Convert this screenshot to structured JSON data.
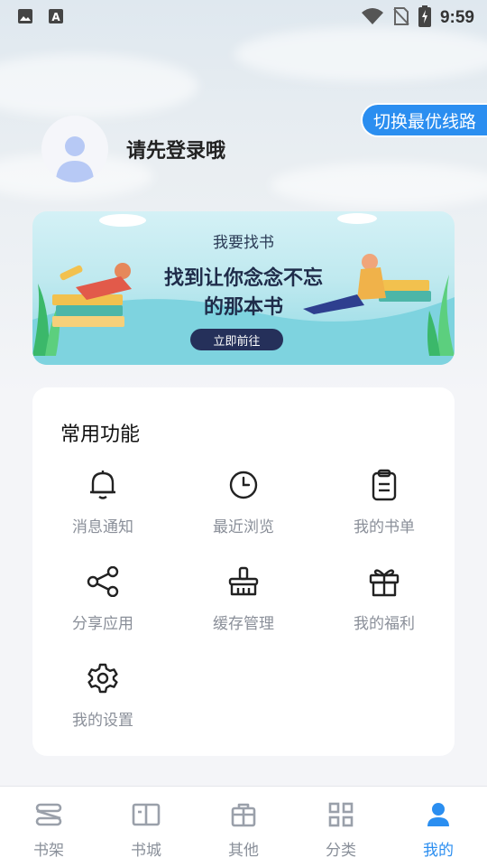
{
  "status_bar": {
    "time": "9:59",
    "icons": [
      "image-icon",
      "text-a-icon",
      "wifi-icon",
      "no-sim-icon",
      "battery-charging-icon"
    ]
  },
  "switch_route_label": "切换最优线路",
  "profile": {
    "login_prompt": "请先登录哦"
  },
  "banner": {
    "title": "我要找书",
    "line1": "找到让你念念不忘",
    "line2": "的那本书",
    "button": "立即前往"
  },
  "functions": {
    "title": "常用功能",
    "items": [
      {
        "label": "消息通知",
        "icon": "bell-icon"
      },
      {
        "label": "最近浏览",
        "icon": "clock-icon"
      },
      {
        "label": "我的书单",
        "icon": "clipboard-icon"
      },
      {
        "label": "分享应用",
        "icon": "share-icon"
      },
      {
        "label": "缓存管理",
        "icon": "basket-icon"
      },
      {
        "label": "我的福利",
        "icon": "gift-icon"
      },
      {
        "label": "我的设置",
        "icon": "gear-icon"
      }
    ]
  },
  "tabs": [
    {
      "label": "书架",
      "icon": "bookshelf-icon",
      "active": false
    },
    {
      "label": "书城",
      "icon": "open-book-icon",
      "active": false
    },
    {
      "label": "其他",
      "icon": "bag-icon",
      "active": false
    },
    {
      "label": "分类",
      "icon": "grid-icon",
      "active": false
    },
    {
      "label": "我的",
      "icon": "person-icon",
      "active": true
    }
  ],
  "colors": {
    "accent": "#2b8ef0",
    "inactive": "#8a909a",
    "icon_stroke": "#222222"
  }
}
